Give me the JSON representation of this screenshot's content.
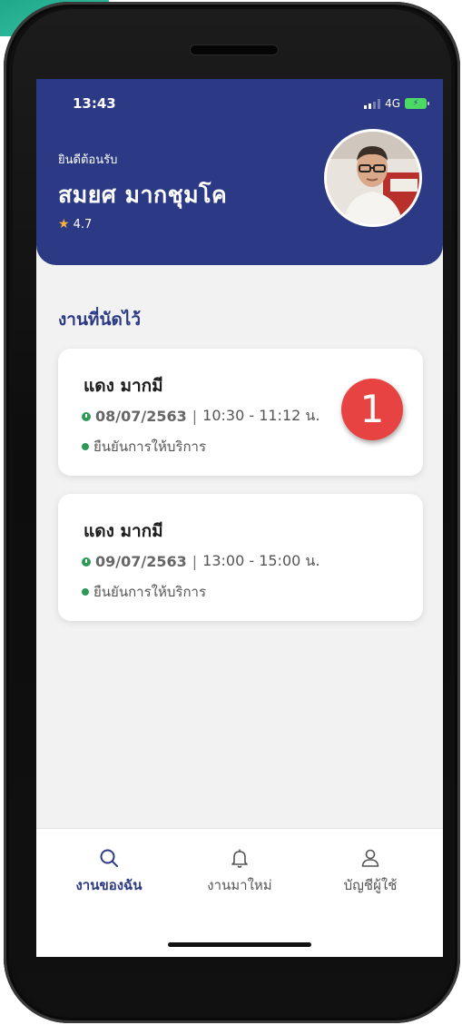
{
  "status_bar": {
    "time": "13:43",
    "network": "4G"
  },
  "header": {
    "welcome": "ยินดีต้อนรับ",
    "user_name": "สมยศ มากชุมโค",
    "rating": "4.7"
  },
  "section_title": "งานที่นัดไว้",
  "appointments": [
    {
      "name": "แดง มากมี",
      "date": "08/07/2563",
      "time": "10:30 - 11:12 น.",
      "status": "ยืนยันการให้บริการ"
    },
    {
      "name": "แดง มากมี",
      "date": "09/07/2563",
      "time": "13:00 - 15:00 น.",
      "status": "ยืนยันการให้บริการ"
    }
  ],
  "badge": "1",
  "nav": [
    {
      "label": "งานของฉัน",
      "icon": "search-icon",
      "active": true
    },
    {
      "label": "งานมาใหม่",
      "icon": "bell-icon",
      "active": false
    },
    {
      "label": "บัญชีผู้ใช้",
      "icon": "user-icon",
      "active": false
    }
  ],
  "colors": {
    "primary": "#2c3a86",
    "status_green": "#2e9a58",
    "badge_red": "#e84343",
    "star": "#f4b23a"
  }
}
